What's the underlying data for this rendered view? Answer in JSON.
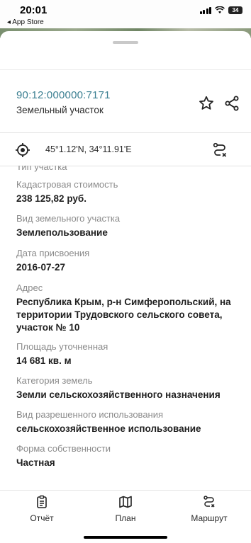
{
  "status_bar": {
    "time": "20:01",
    "back_label": "◂ App Store",
    "battery": "34"
  },
  "object": {
    "cadastral_number": "90:12:000000:7171",
    "type": "Земельный участок",
    "coordinates": "45°1.12'N, 34°11.91'E"
  },
  "cut_off_label": "Тип участка",
  "fields": [
    {
      "label": "Кадастровая стоимость",
      "value": "238 125,82 руб."
    },
    {
      "label": "Вид земельного участка",
      "value": "Землепользование"
    },
    {
      "label": "Дата присвоения",
      "value": "2016-07-27"
    },
    {
      "label": "Адрес",
      "value": "Республика Крым, р-н Симферопольский, на территории Трудовского сельского совета, участок № 10"
    },
    {
      "label": "Площадь уточненная",
      "value": "14 681 кв. м"
    },
    {
      "label": "Категория земель",
      "value": "Земли сельскохозяйственного назначения"
    },
    {
      "label": "Вид разрешенного использования",
      "value": "сельскохозяйственное использование"
    },
    {
      "label": "Форма собственности",
      "value": "Частная"
    }
  ],
  "tabs": [
    {
      "label": "Отчёт",
      "icon": "clipboard-icon"
    },
    {
      "label": "План",
      "icon": "map-icon"
    },
    {
      "label": "Маршрут",
      "icon": "route-icon"
    }
  ],
  "colors": {
    "accent": "#3b7f91",
    "label": "#8a8a8a",
    "value": "#1f1f1f"
  }
}
